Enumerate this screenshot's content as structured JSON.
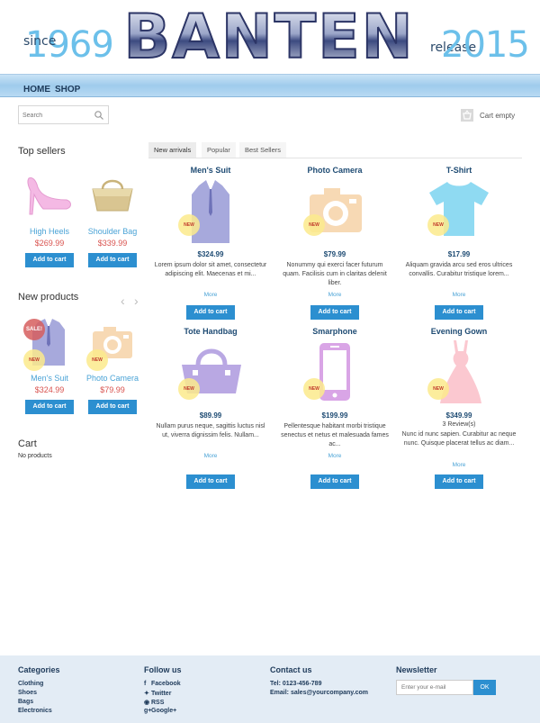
{
  "header": {
    "since": "since",
    "year_left": "1969",
    "logo": "BANTEN",
    "release": "release",
    "year_right": "2015"
  },
  "nav": {
    "items": [
      "HOME",
      "SHOP"
    ]
  },
  "search": {
    "placeholder": "Search"
  },
  "cart": {
    "label": "Cart empty"
  },
  "sidebar": {
    "top_sellers_title": "Top sellers",
    "top_sellers": [
      {
        "name": "High Heels",
        "price": "$269.99",
        "button": "Add to cart",
        "icon": "high-heel-icon"
      },
      {
        "name": "Shoulder Bag",
        "price": "$339.99",
        "button": "Add to cart",
        "icon": "shoulder-bag-icon"
      }
    ],
    "new_products_title": "New products",
    "new_products": [
      {
        "name": "Men's Suit",
        "price": "$324.99",
        "button": "Add to cart",
        "badge_sale": "SALE!",
        "badge_new": "NEW"
      },
      {
        "name": "Photo Camera",
        "price": "$79.99",
        "button": "Add to cart",
        "badge_new": "NEW"
      }
    ],
    "cart_title": "Cart",
    "cart_text": "No products"
  },
  "tabs": [
    "New arrivals",
    "Popular",
    "Best Sellers"
  ],
  "products": [
    {
      "name": "Men's Suit",
      "price": "$324.99",
      "desc": "Lorem ipsum dolor sit amet, consectetur adipiscing elit. Maecenas et mi...",
      "more": "More",
      "button": "Add to cart",
      "badge": "NEW"
    },
    {
      "name": "Photo Camera",
      "price": "$79.99",
      "desc": "Nonummy qui exerci facer futurum quam. Facilisis cum in claritas delenit liber.",
      "more": "More",
      "button": "Add to cart",
      "badge": "NEW"
    },
    {
      "name": "T-Shirt",
      "price": "$17.99",
      "desc": "Aliquam gravida arcu sed eros ultrices convallis. Curabitur tristique lorem...",
      "more": "More",
      "button": "Add to cart",
      "badge": "NEW"
    },
    {
      "name": "Tote Handbag",
      "price": "$89.99",
      "desc": "Nullam purus neque, sagittis luctus nisl ut, viverra dignissim felis. Nullam...",
      "more": "More",
      "button": "Add to cart",
      "badge": "NEW"
    },
    {
      "name": "Smarphone",
      "price": "$199.99",
      "desc": "Pellentesque habitant morbi tristique senectus et netus et malesuada fames ac...",
      "more": "More",
      "button": "Add to cart",
      "badge": "NEW"
    },
    {
      "name": "Evening Gown",
      "price": "$349.99",
      "reviews": "3 Review(s)",
      "desc": "Nunc id nunc sapien. Curabitur ac neque nunc. Quisque placerat tellus ac diam...",
      "more": "More",
      "button": "Add to cart",
      "badge": "NEW"
    }
  ],
  "footer": {
    "categories_title": "Categories",
    "categories": [
      "Clothing",
      "Shoes",
      "Bags",
      "Electronics"
    ],
    "follow_title": "Follow us",
    "follow": [
      {
        "icon": "facebook-icon",
        "glyph": "f",
        "label": "Facebook"
      },
      {
        "icon": "twitter-icon",
        "glyph": "🐦",
        "label": "Twitter"
      },
      {
        "icon": "rss-icon",
        "glyph": "◉",
        "label": "RSS"
      },
      {
        "icon": "google-plus-icon",
        "glyph": "g+",
        "label": "Google+"
      }
    ],
    "contact_title": "Contact us",
    "tel": "Tel: 0123-456-789",
    "email": "Email: sales@yourcompany.com",
    "newsletter_title": "Newsletter",
    "newsletter_placeholder": "Enter your e-mail",
    "newsletter_button": "OK"
  },
  "colors": {
    "accent": "#2c8fd0",
    "price_red": "#d9534f",
    "link_blue": "#4aa3d6",
    "title_navy": "#1e4b73"
  }
}
